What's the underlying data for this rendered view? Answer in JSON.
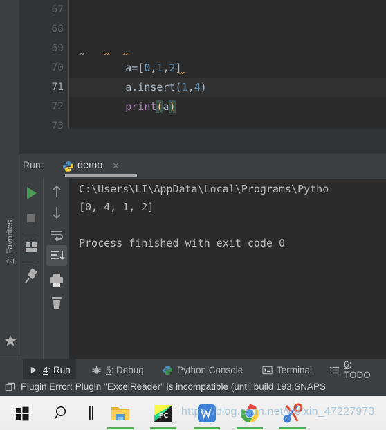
{
  "editor": {
    "line_numbers": [
      "67",
      "68",
      "69",
      "70",
      "71",
      "72",
      "73"
    ],
    "current_line": "71",
    "lines": [
      {
        "n": "67",
        "text": ""
      },
      {
        "n": "68",
        "text": ""
      },
      {
        "n": "69",
        "text": "a=[0,1,2]"
      },
      {
        "n": "70",
        "text": "a.insert(1,4)"
      },
      {
        "n": "71",
        "text": "print(a)"
      },
      {
        "n": "72",
        "text": ""
      },
      {
        "n": "73",
        "text": ""
      }
    ],
    "code_69_a": "a=[",
    "code_69_n0": "0",
    "code_69_c1": ",",
    "code_69_n1": "1",
    "code_69_c2": ",",
    "code_69_n2": "2",
    "code_69_end": "]",
    "code_70_a": "a.insert(",
    "code_70_n0": "1",
    "code_70_c1": ",",
    "code_70_n1": "4",
    "code_70_end": ")",
    "code_71_kw": "print",
    "code_71_op": "(",
    "code_71_arg": "a",
    "code_71_cp": ")"
  },
  "run_panel": {
    "label": "Run:",
    "tab_name": "demo",
    "tab_close": "✕",
    "tab_icon": "python-icon",
    "toolbar_left": [
      {
        "name": "rerun-button",
        "icon": "play-icon"
      },
      {
        "name": "stop-button",
        "icon": "stop-icon"
      },
      {
        "name": "layout-button",
        "icon": "layout-icon"
      },
      {
        "name": "pin-tab-button",
        "icon": "pin-icon"
      }
    ],
    "toolbar_right": [
      {
        "name": "up-button",
        "icon": "arrow-up-icon"
      },
      {
        "name": "down-button",
        "icon": "arrow-down-icon"
      },
      {
        "name": "soft-wrap-button",
        "icon": "soft-wrap-icon"
      },
      {
        "name": "scroll-to-end-button",
        "icon": "scroll-end-icon",
        "selected": true
      },
      {
        "name": "print-button",
        "icon": "printer-icon"
      },
      {
        "name": "clear-all-button",
        "icon": "trash-icon"
      }
    ],
    "console": [
      "C:\\Users\\LI\\AppData\\Local\\Programs\\Pytho",
      "[0, 4, 1, 2]",
      "",
      "Process finished with exit code 0"
    ]
  },
  "left_tool_bar": {
    "favorites_num": "2",
    "favorites_label": ": Favorites",
    "favorites_icon": "star-icon"
  },
  "bottom_tabs": [
    {
      "num": "4",
      "label": ": Run",
      "icon": "play-icon",
      "active": true
    },
    {
      "num": "5",
      "label": ": Debug",
      "icon": "bug-icon",
      "active": false
    },
    {
      "num": "",
      "label": "Python Console",
      "icon": "python-icon",
      "active": false
    },
    {
      "num": "",
      "label": "Terminal",
      "icon": "terminal-icon",
      "active": false
    },
    {
      "num": "6",
      "label": ": TODO",
      "icon": "list-icon",
      "active": false
    }
  ],
  "status_bar": {
    "icon": "window-icon",
    "text": "Plugin Error: Plugin \"ExcelReader\" is incompatible (until build 193.SNAPS"
  },
  "taskbar": {
    "items": [
      {
        "name": "start-button",
        "icon": "windows-logo-icon"
      },
      {
        "name": "search-button",
        "icon": "search-icon"
      },
      {
        "name": "task-view-button",
        "icon": "task-view-icon"
      },
      {
        "name": "file-explorer-button",
        "icon": "folder-icon",
        "running": true
      },
      {
        "name": "pycharm-button",
        "icon": "pycharm-icon",
        "running": true
      },
      {
        "name": "wps-button",
        "icon": "wps-icon",
        "running": true
      },
      {
        "name": "chrome-button",
        "icon": "chrome-icon",
        "running": true
      },
      {
        "name": "snipping-tool-button",
        "icon": "scissors-icon",
        "running": true
      }
    ],
    "watermark": "https://blog.csdn.net/weixin_47227973"
  },
  "colors": {
    "editor_bg": "#2b2b2b",
    "panel_bg": "#3c3f41",
    "gutter_bg": "#313335",
    "code_fg": "#a9b7c6",
    "number_fg": "#6897bb",
    "keyword_fg": "#b389c5",
    "brace_hl": "#3b514d",
    "accent_green": "#499c54"
  }
}
